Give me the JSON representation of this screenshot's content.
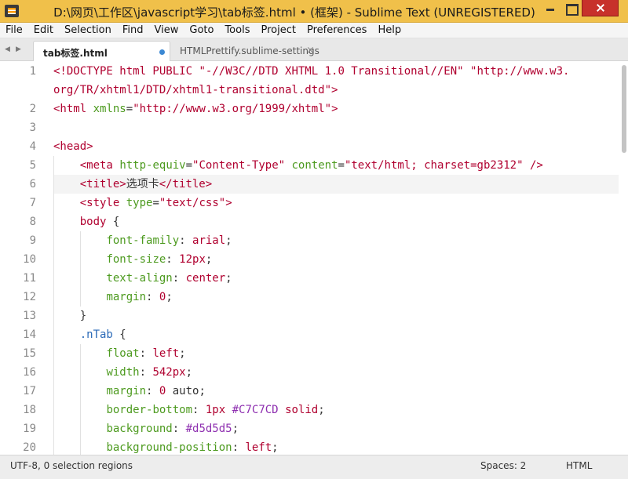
{
  "window": {
    "title": "D:\\网页\\工作区\\javascript学习\\tab标签.html • (框架) - Sublime Text (UNREGISTERED)"
  },
  "menu": [
    "File",
    "Edit",
    "Selection",
    "Find",
    "View",
    "Goto",
    "Tools",
    "Project",
    "Preferences",
    "Help"
  ],
  "tabs": [
    {
      "label": "tab标签.html",
      "active": true,
      "modified": true
    },
    {
      "label": "HTMLPrettify.sublime-settings",
      "active": false,
      "close": "×"
    }
  ],
  "editor": {
    "line_numbers": [
      "1",
      "",
      "2",
      "3",
      "4",
      "5",
      "6",
      "7",
      "8",
      "9",
      "10",
      "11",
      "12",
      "13",
      "14",
      "15",
      "16",
      "17",
      "18",
      "19",
      "20"
    ],
    "lines": [
      [
        [
          "c-doc",
          "<!DOCTYPE html PUBLIC "
        ],
        [
          "c-str",
          "\"-//W3C//DTD XHTML 1.0 Transitional//EN\""
        ],
        [
          "c-pun",
          " "
        ],
        [
          "c-str",
          "\"http://www.w3."
        ]
      ],
      [
        [
          "c-str",
          "org/TR/xhtml1/DTD/xhtml1-transitional.dtd\""
        ],
        [
          "c-tag",
          ">"
        ]
      ],
      [
        [
          "c-tag",
          "<html"
        ],
        [
          "c-pun",
          " "
        ],
        [
          "c-attr",
          "xmlns"
        ],
        [
          "c-pun",
          "="
        ],
        [
          "c-str",
          "\"http://www.w3.org/1999/xhtml\""
        ],
        [
          "c-tag",
          ">"
        ]
      ],
      [],
      [
        [
          "c-tag",
          "<head>"
        ]
      ],
      [
        [
          "c-pun",
          "    "
        ],
        [
          "c-tag",
          "<meta"
        ],
        [
          "c-pun",
          " "
        ],
        [
          "c-attr",
          "http-equiv"
        ],
        [
          "c-pun",
          "="
        ],
        [
          "c-str",
          "\"Content-Type\""
        ],
        [
          "c-pun",
          " "
        ],
        [
          "c-attr",
          "content"
        ],
        [
          "c-pun",
          "="
        ],
        [
          "c-str",
          "\"text/html; charset=gb2312\""
        ],
        [
          "c-pun",
          " "
        ],
        [
          "c-tag",
          "/>"
        ]
      ],
      [
        [
          "c-pun",
          "    "
        ],
        [
          "c-tag",
          "<title>"
        ],
        [
          "c-pun",
          "选项卡"
        ],
        [
          "c-tag",
          "</title>"
        ]
      ],
      [
        [
          "c-pun",
          "    "
        ],
        [
          "c-tag",
          "<style"
        ],
        [
          "c-pun",
          " "
        ],
        [
          "c-attr",
          "type"
        ],
        [
          "c-pun",
          "="
        ],
        [
          "c-str",
          "\"text/css\""
        ],
        [
          "c-tag",
          ">"
        ]
      ],
      [
        [
          "c-pun",
          "    "
        ],
        [
          "c-tag",
          "body"
        ],
        [
          "c-pun",
          " {"
        ]
      ],
      [
        [
          "c-pun",
          "        "
        ],
        [
          "c-prop",
          "font-family"
        ],
        [
          "c-pun",
          ": "
        ],
        [
          "c-val",
          "arial"
        ],
        [
          "c-pun",
          ";"
        ]
      ],
      [
        [
          "c-pun",
          "        "
        ],
        [
          "c-prop",
          "font-size"
        ],
        [
          "c-pun",
          ": "
        ],
        [
          "c-num",
          "12px"
        ],
        [
          "c-pun",
          ";"
        ]
      ],
      [
        [
          "c-pun",
          "        "
        ],
        [
          "c-prop",
          "text-align"
        ],
        [
          "c-pun",
          ": "
        ],
        [
          "c-val",
          "center"
        ],
        [
          "c-pun",
          ";"
        ]
      ],
      [
        [
          "c-pun",
          "        "
        ],
        [
          "c-prop",
          "margin"
        ],
        [
          "c-pun",
          ": "
        ],
        [
          "c-num",
          "0"
        ],
        [
          "c-pun",
          ";"
        ]
      ],
      [
        [
          "c-pun",
          "    }"
        ]
      ],
      [
        [
          "c-pun",
          "    "
        ],
        [
          "c-sel",
          ".nTab"
        ],
        [
          "c-pun",
          " {"
        ]
      ],
      [
        [
          "c-pun",
          "        "
        ],
        [
          "c-prop",
          "float"
        ],
        [
          "c-pun",
          ": "
        ],
        [
          "c-val",
          "left"
        ],
        [
          "c-pun",
          ";"
        ]
      ],
      [
        [
          "c-pun",
          "        "
        ],
        [
          "c-prop",
          "width"
        ],
        [
          "c-pun",
          ": "
        ],
        [
          "c-num",
          "542px"
        ],
        [
          "c-pun",
          ";"
        ]
      ],
      [
        [
          "c-pun",
          "        "
        ],
        [
          "c-prop",
          "margin"
        ],
        [
          "c-pun",
          ": "
        ],
        [
          "c-num",
          "0"
        ],
        [
          "c-pun",
          " auto;"
        ]
      ],
      [
        [
          "c-pun",
          "        "
        ],
        [
          "c-prop",
          "border-bottom"
        ],
        [
          "c-pun",
          ": "
        ],
        [
          "c-num",
          "1px"
        ],
        [
          "c-pun",
          " "
        ],
        [
          "c-color",
          "#C7C7CD"
        ],
        [
          "c-pun",
          " "
        ],
        [
          "c-val",
          "solid"
        ],
        [
          "c-pun",
          ";"
        ]
      ],
      [
        [
          "c-pun",
          "        "
        ],
        [
          "c-prop",
          "background"
        ],
        [
          "c-pun",
          ": "
        ],
        [
          "c-color",
          "#d5d5d5"
        ],
        [
          "c-pun",
          ";"
        ]
      ],
      [
        [
          "c-pun",
          "        "
        ],
        [
          "c-prop",
          "background-position"
        ],
        [
          "c-pun",
          ": "
        ],
        [
          "c-val",
          "left"
        ],
        [
          "c-pun",
          ";"
        ]
      ]
    ]
  },
  "status": {
    "left": "UTF-8, 0 selection regions",
    "spaces": "Spaces: 2",
    "syntax": "HTML"
  }
}
